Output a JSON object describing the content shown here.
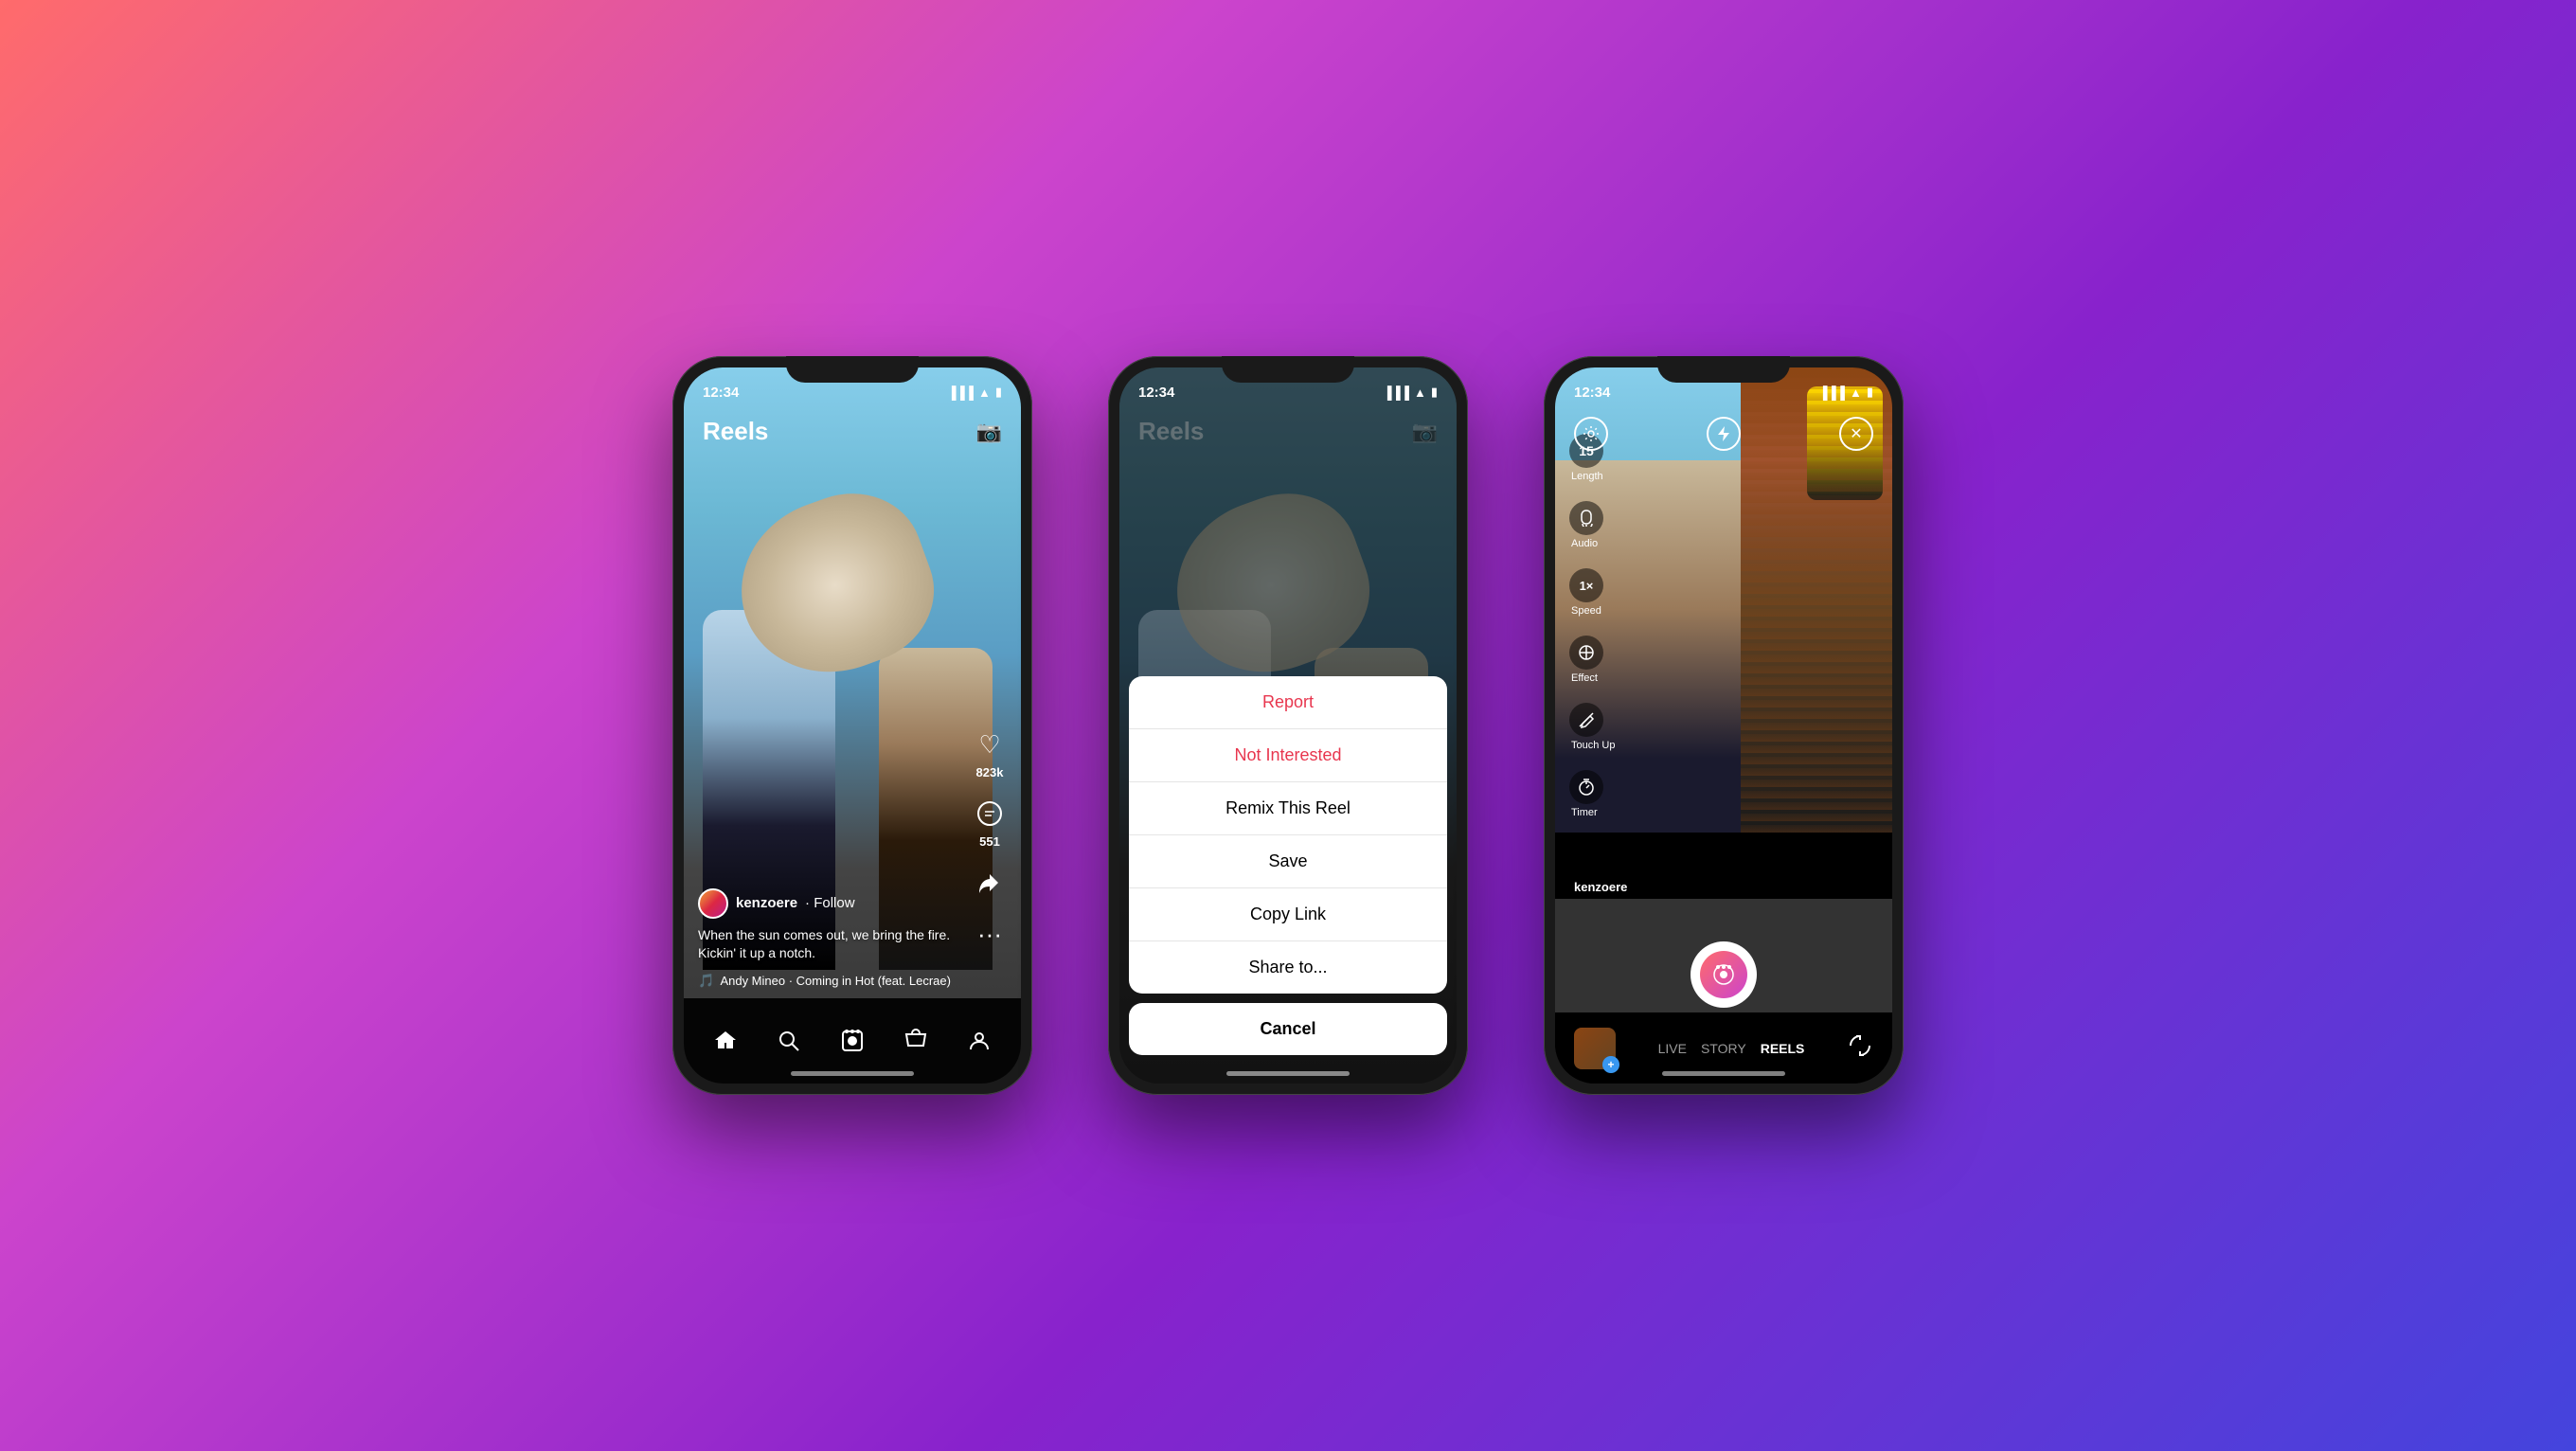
{
  "background": {
    "gradient": "linear-gradient(135deg, #ff6b6b 0%, #cc44cc 30%, #8822cc 60%, #4444dd 100%)"
  },
  "phone1": {
    "status_time": "12:34",
    "header_title": "Reels",
    "camera_icon": "📷",
    "like_count": "823k",
    "comment_count": "551",
    "username": "kenzoere",
    "follow_text": "· Follow",
    "caption_line1": "When the sun comes out, we bring the fire.",
    "caption_line2": "Kickin' it up a notch.",
    "music_artist": "Andy Mineo · Coming in Hot (feat. Lecrae)",
    "nav_home": "⌂",
    "nav_search": "🔍",
    "nav_reels": "▶",
    "nav_shop": "🛍",
    "nav_profile": "👤"
  },
  "phone2": {
    "status_time": "12:34",
    "header_title": "Reels",
    "camera_icon": "📷",
    "sheet_items": [
      {
        "label": "Report",
        "style": "red"
      },
      {
        "label": "Not Interested",
        "style": "red"
      },
      {
        "label": "Remix This Reel",
        "style": "normal"
      },
      {
        "label": "Save",
        "style": "normal"
      },
      {
        "label": "Copy Link",
        "style": "normal"
      },
      {
        "label": "Share to...",
        "style": "normal"
      }
    ],
    "cancel_label": "Cancel"
  },
  "phone3": {
    "status_time": "12:34",
    "length_label": "Length",
    "length_value": "15",
    "audio_label": "Audio",
    "speed_label": "Speed",
    "speed_value": "1×",
    "effect_label": "Effect",
    "touchup_label": "Touch Up",
    "timer_label": "Timer",
    "close_icon": "✕",
    "username": "kenzoere",
    "mode_live": "LIVE",
    "mode_story": "STORY",
    "mode_reels": "REELS",
    "mode_active": "REELS"
  }
}
